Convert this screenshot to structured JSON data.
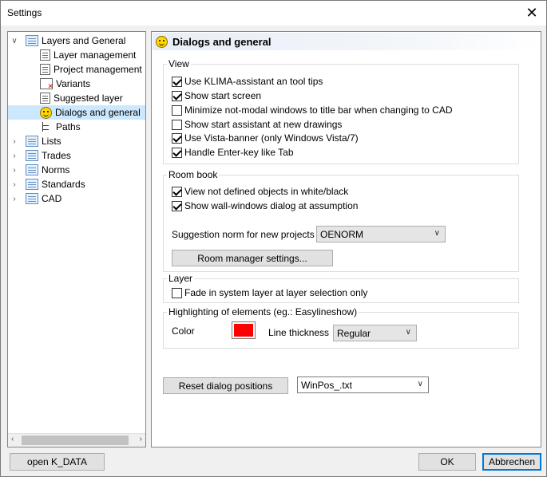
{
  "window": {
    "title": "Settings",
    "close_glyph": "✕"
  },
  "tree": {
    "items": [
      {
        "label": "Layers and General",
        "icon": "list-icon",
        "arrow": "∨"
      },
      {
        "label": "Layer management",
        "icon": "document-icon"
      },
      {
        "label": "Project management",
        "icon": "document-icon"
      },
      {
        "label": "Variants",
        "icon": "variants-icon"
      },
      {
        "label": "Suggested layer",
        "icon": "document-icon"
      },
      {
        "label": "Dialogs and general",
        "icon": "smiley-icon"
      },
      {
        "label": "Paths",
        "icon": "paths-icon"
      },
      {
        "label": "Lists",
        "icon": "list-icon",
        "arrow": "›"
      },
      {
        "label": "Trades",
        "icon": "list-icon",
        "arrow": "›"
      },
      {
        "label": "Norms",
        "icon": "list-icon",
        "arrow": "›"
      },
      {
        "label": "Standards",
        "icon": "list-icon",
        "arrow": "›"
      },
      {
        "label": "CAD",
        "icon": "list-icon",
        "arrow": "›"
      }
    ],
    "selected": "Dialogs and general",
    "scroll_left": "‹",
    "scroll_right": "›"
  },
  "panel": {
    "title": "Dialogs and general",
    "view": {
      "label": "View",
      "options": [
        {
          "label": "Use KLIMA-assistant an tool tips",
          "checked": true
        },
        {
          "label": "Show start screen",
          "checked": true
        },
        {
          "label": "Minimize not-modal windows to title bar when changing to CAD",
          "checked": false
        },
        {
          "label": "Show start assistant at new drawings",
          "checked": false
        },
        {
          "label": "Use Vista-banner (only Windows Vista/7)",
          "checked": true
        },
        {
          "label": "Handle Enter-key like Tab",
          "checked": true
        }
      ]
    },
    "room_book": {
      "label": "Room book",
      "options": [
        {
          "label": "View not defined objects in white/black",
          "checked": true
        },
        {
          "label": "Show wall-windows dialog at assumption",
          "checked": true
        }
      ],
      "norm_label": "Suggestion norm for new projects",
      "norm_value": "OENORM",
      "manager_button": "Room manager settings..."
    },
    "layer": {
      "label": "Layer",
      "options": [
        {
          "label": "Fade in system layer at layer selection only",
          "checked": false
        }
      ]
    },
    "highlighting": {
      "label": "Highlighting of elements (eg.: Easylineshow)",
      "color_label": "Color",
      "color_value": "#ff0000",
      "thickness_label": "Line thickness",
      "thickness_value": "Regular"
    },
    "reset_button": "Reset dialog positions",
    "winpos_value": "WinPos_.txt"
  },
  "footer": {
    "open_button": "open K_DATA",
    "ok_button": "OK",
    "cancel_button": "Abbrechen"
  }
}
